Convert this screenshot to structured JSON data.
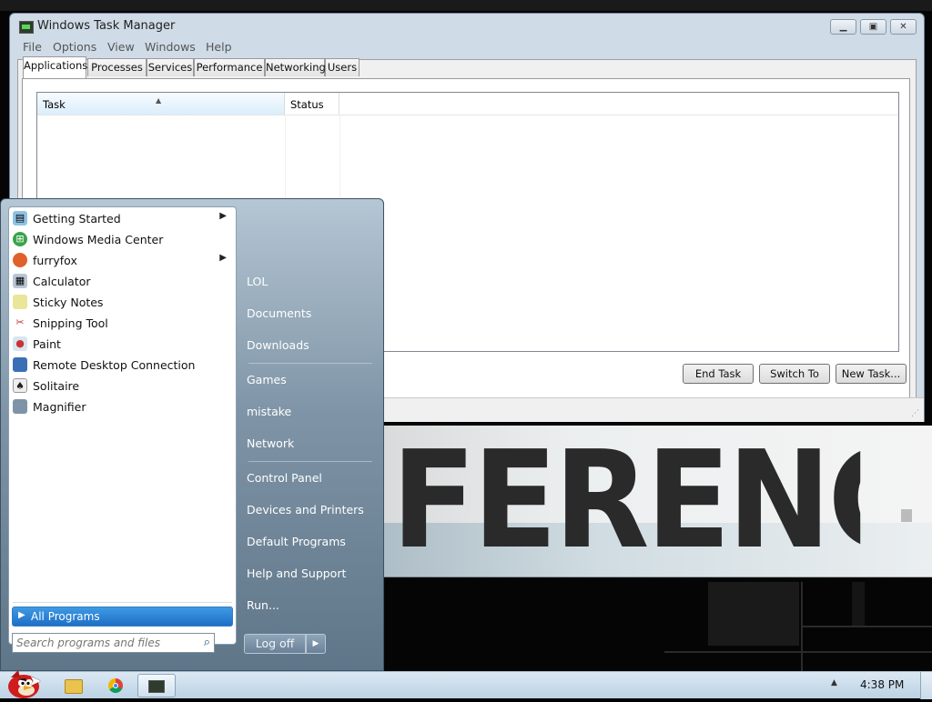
{
  "desktop": {
    "wallpaper_text": "FERENCE"
  },
  "task_manager": {
    "title": "Windows Task Manager",
    "menu": [
      "File",
      "Options",
      "View",
      "Windows",
      "Help"
    ],
    "tabs": [
      "Applications",
      "Processes",
      "Services",
      "Performance",
      "Networking",
      "Users"
    ],
    "active_tab": "Applications",
    "columns": [
      "Task",
      "Status"
    ],
    "rows": [],
    "buttons": {
      "end_task": "End Task",
      "switch_to": "Switch To",
      "new_task": "New Task..."
    }
  },
  "start_menu": {
    "programs": [
      {
        "label": "Getting Started",
        "icon": "getting-started-icon",
        "submenu": true
      },
      {
        "label": "Windows Media Center",
        "icon": "media-center-icon",
        "submenu": false
      },
      {
        "label": "furryfox",
        "icon": "firefox-icon",
        "submenu": true
      },
      {
        "label": "Calculator",
        "icon": "calculator-icon",
        "submenu": false
      },
      {
        "label": "Sticky Notes",
        "icon": "sticky-notes-icon",
        "submenu": false
      },
      {
        "label": "Snipping Tool",
        "icon": "scissors-icon",
        "submenu": false
      },
      {
        "label": "Paint",
        "icon": "paint-palette-icon",
        "submenu": false
      },
      {
        "label": "Remote Desktop Connection",
        "icon": "remote-desktop-icon",
        "submenu": false
      },
      {
        "label": "Solitaire",
        "icon": "cards-icon",
        "submenu": false
      },
      {
        "label": "Magnifier",
        "icon": "magnifier-icon",
        "submenu": false
      }
    ],
    "all_programs": "All Programs",
    "search_placeholder": "Search programs and files",
    "right_items": [
      "LOL",
      "Documents",
      "Downloads",
      "Games",
      "mistake",
      "Network",
      "Control Panel",
      "Devices and Printers",
      "Default Programs",
      "Help and Support",
      "Run..."
    ],
    "log_off": "Log off"
  },
  "taskbar": {
    "pinned": [
      "explorer-folder-icon",
      "chrome-icon",
      "task-manager-icon"
    ],
    "clock": "4:38 PM"
  },
  "colors": {
    "start_menu_blue": "#7f95a7",
    "all_programs_highlight": "#1d6fc6",
    "taskbar": "#bcd2e5"
  }
}
